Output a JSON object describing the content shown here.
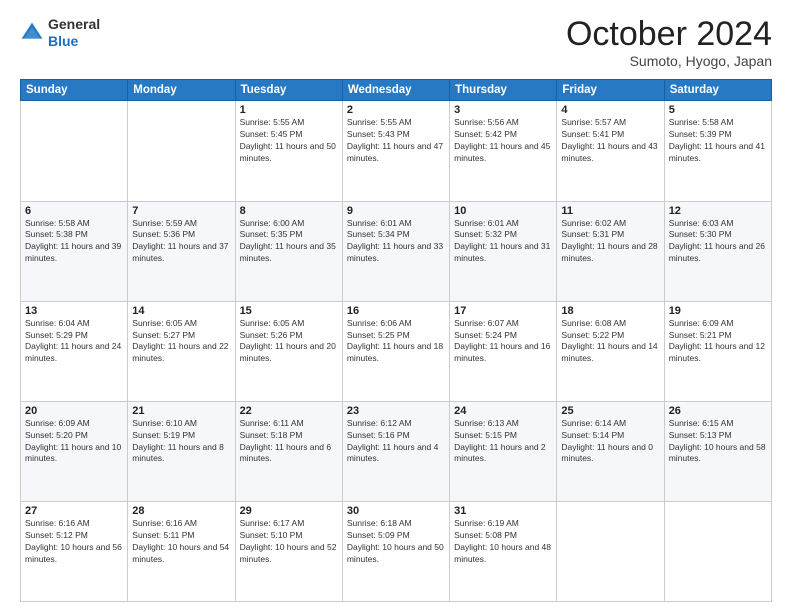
{
  "header": {
    "logo_general": "General",
    "logo_blue": "Blue",
    "month_title": "October 2024",
    "location": "Sumoto, Hyogo, Japan"
  },
  "weekdays": [
    "Sunday",
    "Monday",
    "Tuesday",
    "Wednesday",
    "Thursday",
    "Friday",
    "Saturday"
  ],
  "weeks": [
    [
      {
        "day": "",
        "sunrise": "",
        "sunset": "",
        "daylight": ""
      },
      {
        "day": "",
        "sunrise": "",
        "sunset": "",
        "daylight": ""
      },
      {
        "day": "1",
        "sunrise": "Sunrise: 5:55 AM",
        "sunset": "Sunset: 5:45 PM",
        "daylight": "Daylight: 11 hours and 50 minutes."
      },
      {
        "day": "2",
        "sunrise": "Sunrise: 5:55 AM",
        "sunset": "Sunset: 5:43 PM",
        "daylight": "Daylight: 11 hours and 47 minutes."
      },
      {
        "day": "3",
        "sunrise": "Sunrise: 5:56 AM",
        "sunset": "Sunset: 5:42 PM",
        "daylight": "Daylight: 11 hours and 45 minutes."
      },
      {
        "day": "4",
        "sunrise": "Sunrise: 5:57 AM",
        "sunset": "Sunset: 5:41 PM",
        "daylight": "Daylight: 11 hours and 43 minutes."
      },
      {
        "day": "5",
        "sunrise": "Sunrise: 5:58 AM",
        "sunset": "Sunset: 5:39 PM",
        "daylight": "Daylight: 11 hours and 41 minutes."
      }
    ],
    [
      {
        "day": "6",
        "sunrise": "Sunrise: 5:58 AM",
        "sunset": "Sunset: 5:38 PM",
        "daylight": "Daylight: 11 hours and 39 minutes."
      },
      {
        "day": "7",
        "sunrise": "Sunrise: 5:59 AM",
        "sunset": "Sunset: 5:36 PM",
        "daylight": "Daylight: 11 hours and 37 minutes."
      },
      {
        "day": "8",
        "sunrise": "Sunrise: 6:00 AM",
        "sunset": "Sunset: 5:35 PM",
        "daylight": "Daylight: 11 hours and 35 minutes."
      },
      {
        "day": "9",
        "sunrise": "Sunrise: 6:01 AM",
        "sunset": "Sunset: 5:34 PM",
        "daylight": "Daylight: 11 hours and 33 minutes."
      },
      {
        "day": "10",
        "sunrise": "Sunrise: 6:01 AM",
        "sunset": "Sunset: 5:32 PM",
        "daylight": "Daylight: 11 hours and 31 minutes."
      },
      {
        "day": "11",
        "sunrise": "Sunrise: 6:02 AM",
        "sunset": "Sunset: 5:31 PM",
        "daylight": "Daylight: 11 hours and 28 minutes."
      },
      {
        "day": "12",
        "sunrise": "Sunrise: 6:03 AM",
        "sunset": "Sunset: 5:30 PM",
        "daylight": "Daylight: 11 hours and 26 minutes."
      }
    ],
    [
      {
        "day": "13",
        "sunrise": "Sunrise: 6:04 AM",
        "sunset": "Sunset: 5:29 PM",
        "daylight": "Daylight: 11 hours and 24 minutes."
      },
      {
        "day": "14",
        "sunrise": "Sunrise: 6:05 AM",
        "sunset": "Sunset: 5:27 PM",
        "daylight": "Daylight: 11 hours and 22 minutes."
      },
      {
        "day": "15",
        "sunrise": "Sunrise: 6:05 AM",
        "sunset": "Sunset: 5:26 PM",
        "daylight": "Daylight: 11 hours and 20 minutes."
      },
      {
        "day": "16",
        "sunrise": "Sunrise: 6:06 AM",
        "sunset": "Sunset: 5:25 PM",
        "daylight": "Daylight: 11 hours and 18 minutes."
      },
      {
        "day": "17",
        "sunrise": "Sunrise: 6:07 AM",
        "sunset": "Sunset: 5:24 PM",
        "daylight": "Daylight: 11 hours and 16 minutes."
      },
      {
        "day": "18",
        "sunrise": "Sunrise: 6:08 AM",
        "sunset": "Sunset: 5:22 PM",
        "daylight": "Daylight: 11 hours and 14 minutes."
      },
      {
        "day": "19",
        "sunrise": "Sunrise: 6:09 AM",
        "sunset": "Sunset: 5:21 PM",
        "daylight": "Daylight: 11 hours and 12 minutes."
      }
    ],
    [
      {
        "day": "20",
        "sunrise": "Sunrise: 6:09 AM",
        "sunset": "Sunset: 5:20 PM",
        "daylight": "Daylight: 11 hours and 10 minutes."
      },
      {
        "day": "21",
        "sunrise": "Sunrise: 6:10 AM",
        "sunset": "Sunset: 5:19 PM",
        "daylight": "Daylight: 11 hours and 8 minutes."
      },
      {
        "day": "22",
        "sunrise": "Sunrise: 6:11 AM",
        "sunset": "Sunset: 5:18 PM",
        "daylight": "Daylight: 11 hours and 6 minutes."
      },
      {
        "day": "23",
        "sunrise": "Sunrise: 6:12 AM",
        "sunset": "Sunset: 5:16 PM",
        "daylight": "Daylight: 11 hours and 4 minutes."
      },
      {
        "day": "24",
        "sunrise": "Sunrise: 6:13 AM",
        "sunset": "Sunset: 5:15 PM",
        "daylight": "Daylight: 11 hours and 2 minutes."
      },
      {
        "day": "25",
        "sunrise": "Sunrise: 6:14 AM",
        "sunset": "Sunset: 5:14 PM",
        "daylight": "Daylight: 11 hours and 0 minutes."
      },
      {
        "day": "26",
        "sunrise": "Sunrise: 6:15 AM",
        "sunset": "Sunset: 5:13 PM",
        "daylight": "Daylight: 10 hours and 58 minutes."
      }
    ],
    [
      {
        "day": "27",
        "sunrise": "Sunrise: 6:16 AM",
        "sunset": "Sunset: 5:12 PM",
        "daylight": "Daylight: 10 hours and 56 minutes."
      },
      {
        "day": "28",
        "sunrise": "Sunrise: 6:16 AM",
        "sunset": "Sunset: 5:11 PM",
        "daylight": "Daylight: 10 hours and 54 minutes."
      },
      {
        "day": "29",
        "sunrise": "Sunrise: 6:17 AM",
        "sunset": "Sunset: 5:10 PM",
        "daylight": "Daylight: 10 hours and 52 minutes."
      },
      {
        "day": "30",
        "sunrise": "Sunrise: 6:18 AM",
        "sunset": "Sunset: 5:09 PM",
        "daylight": "Daylight: 10 hours and 50 minutes."
      },
      {
        "day": "31",
        "sunrise": "Sunrise: 6:19 AM",
        "sunset": "Sunset: 5:08 PM",
        "daylight": "Daylight: 10 hours and 48 minutes."
      },
      {
        "day": "",
        "sunrise": "",
        "sunset": "",
        "daylight": ""
      },
      {
        "day": "",
        "sunrise": "",
        "sunset": "",
        "daylight": ""
      }
    ]
  ]
}
